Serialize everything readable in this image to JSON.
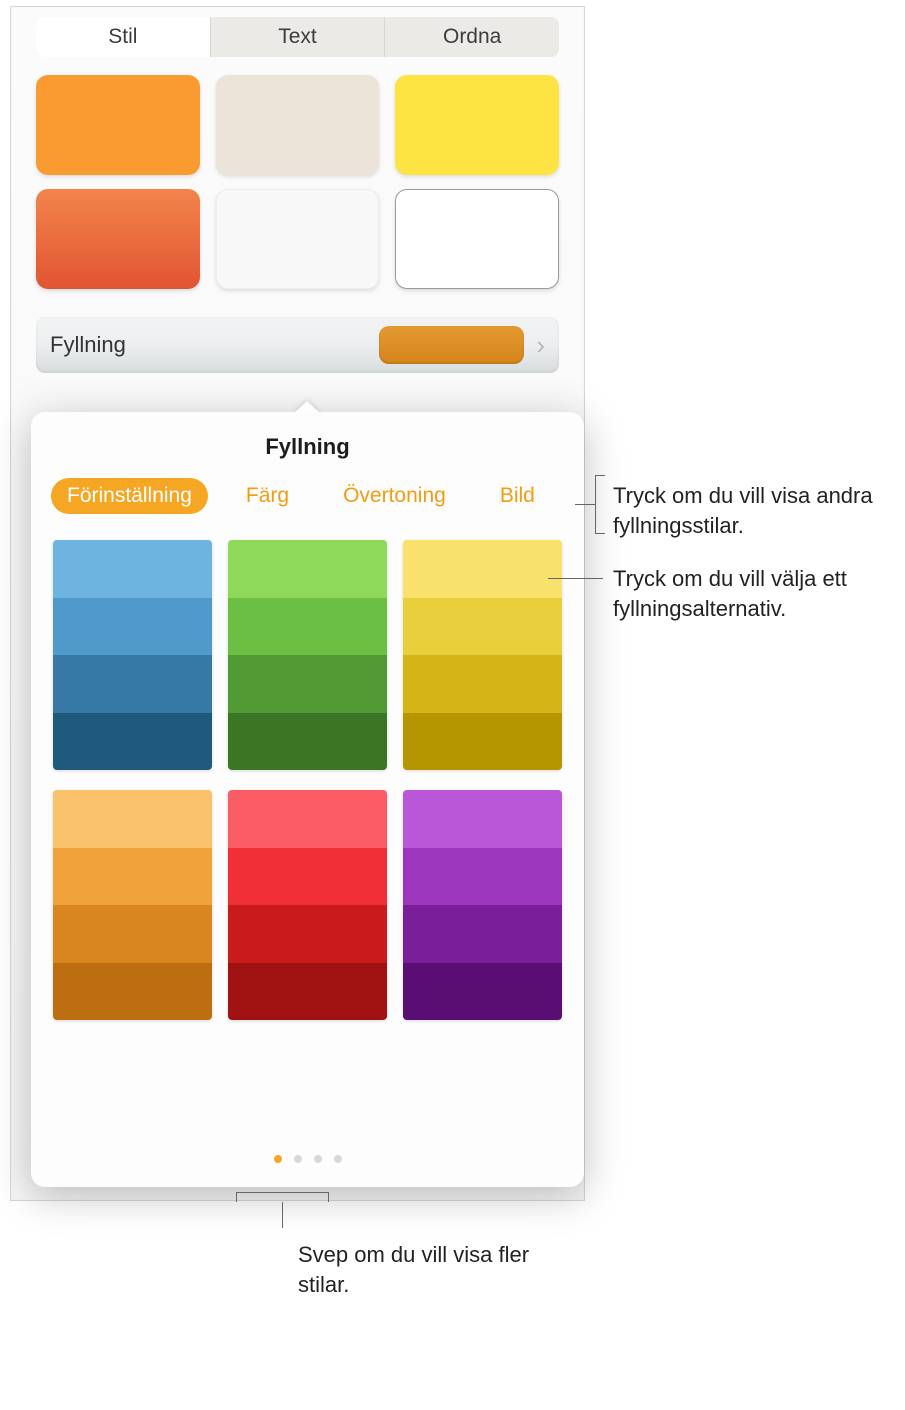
{
  "tabs": {
    "style": "Stil",
    "text": "Text",
    "arrange": "Ordna"
  },
  "fill_row": {
    "label": "Fyllning"
  },
  "popover": {
    "title": "Fyllning",
    "tabs": {
      "preset": "Förinställning",
      "color": "Färg",
      "gradient": "Övertoning",
      "image": "Bild"
    }
  },
  "presets": [
    {
      "bands": [
        "#6db4e0",
        "#4f99cb",
        "#3679a6",
        "#1f5a7d"
      ]
    },
    {
      "bands": [
        "#8fd95a",
        "#6bbf43",
        "#519a33",
        "#3a7624"
      ]
    },
    {
      "bands": [
        "#f8e26b",
        "#e9cf3c",
        "#d4b416",
        "#b59500"
      ]
    },
    {
      "bands": [
        "#fbc26c",
        "#f0a33b",
        "#da8620",
        "#bd6e11"
      ]
    },
    {
      "bands": [
        "#fc5c64",
        "#ef2f35",
        "#c91b1c",
        "#a01111"
      ]
    },
    {
      "bands": [
        "#b957d8",
        "#9b36bd",
        "#7a1e99",
        "#5a0d72"
      ]
    }
  ],
  "page_dots": {
    "count": 4,
    "active": 0
  },
  "callouts": {
    "tabs_text": "Tryck om du vill visa andra fyllningsstilar.",
    "option_text": "Tryck om du vill välja ett fyllningsalternativ.",
    "swipe_text": "Svep om du vill visa fler stilar."
  }
}
